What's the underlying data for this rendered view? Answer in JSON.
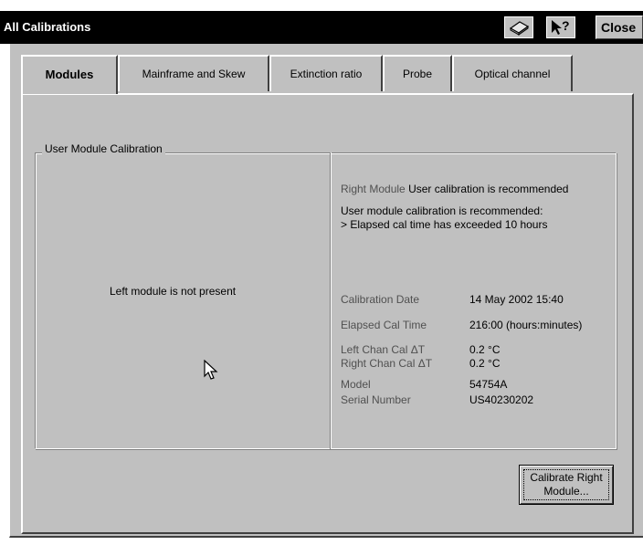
{
  "window": {
    "title": "All Calibrations",
    "close_label": "Close",
    "icons": [
      "eraser-icon",
      "whats-this-help-icon"
    ]
  },
  "tabs": [
    {
      "label": "Modules",
      "active": true
    },
    {
      "label": "Mainframe and Skew",
      "active": false
    },
    {
      "label": "Extinction ratio",
      "active": false
    },
    {
      "label": "Probe",
      "active": false
    },
    {
      "label": "Optical channel",
      "active": false
    }
  ],
  "group": {
    "title": "User Module Calibration",
    "left_status": "Left module is not present",
    "right_heading_label": "Right Module",
    "right_heading_status": "User calibration is recommended",
    "recommend_line1": "User module calibration is recommended:",
    "recommend_line2": "> Elapsed cal time has exceeded 10 hours",
    "fields": {
      "cal_date_label": "Calibration Date",
      "cal_date_value": "14 May 2002  15:40",
      "elapsed_label": "Elapsed Cal Time",
      "elapsed_value": "216:00 (hours:minutes)",
      "left_dt_label": "Left Chan Cal ΔT",
      "left_dt_value": "0.2 °C",
      "right_dt_label": "Right Chan Cal ΔT",
      "right_dt_value": "0.2 °C",
      "model_label": "Model",
      "model_value": "54754A",
      "serial_label": "Serial Number",
      "serial_value": "US40230202"
    }
  },
  "buttons": {
    "calibrate_line1": "Calibrate Right",
    "calibrate_line2": "Module..."
  },
  "colors": {
    "titlebar": "#000000",
    "dialog_face": "#c0c0c0"
  }
}
